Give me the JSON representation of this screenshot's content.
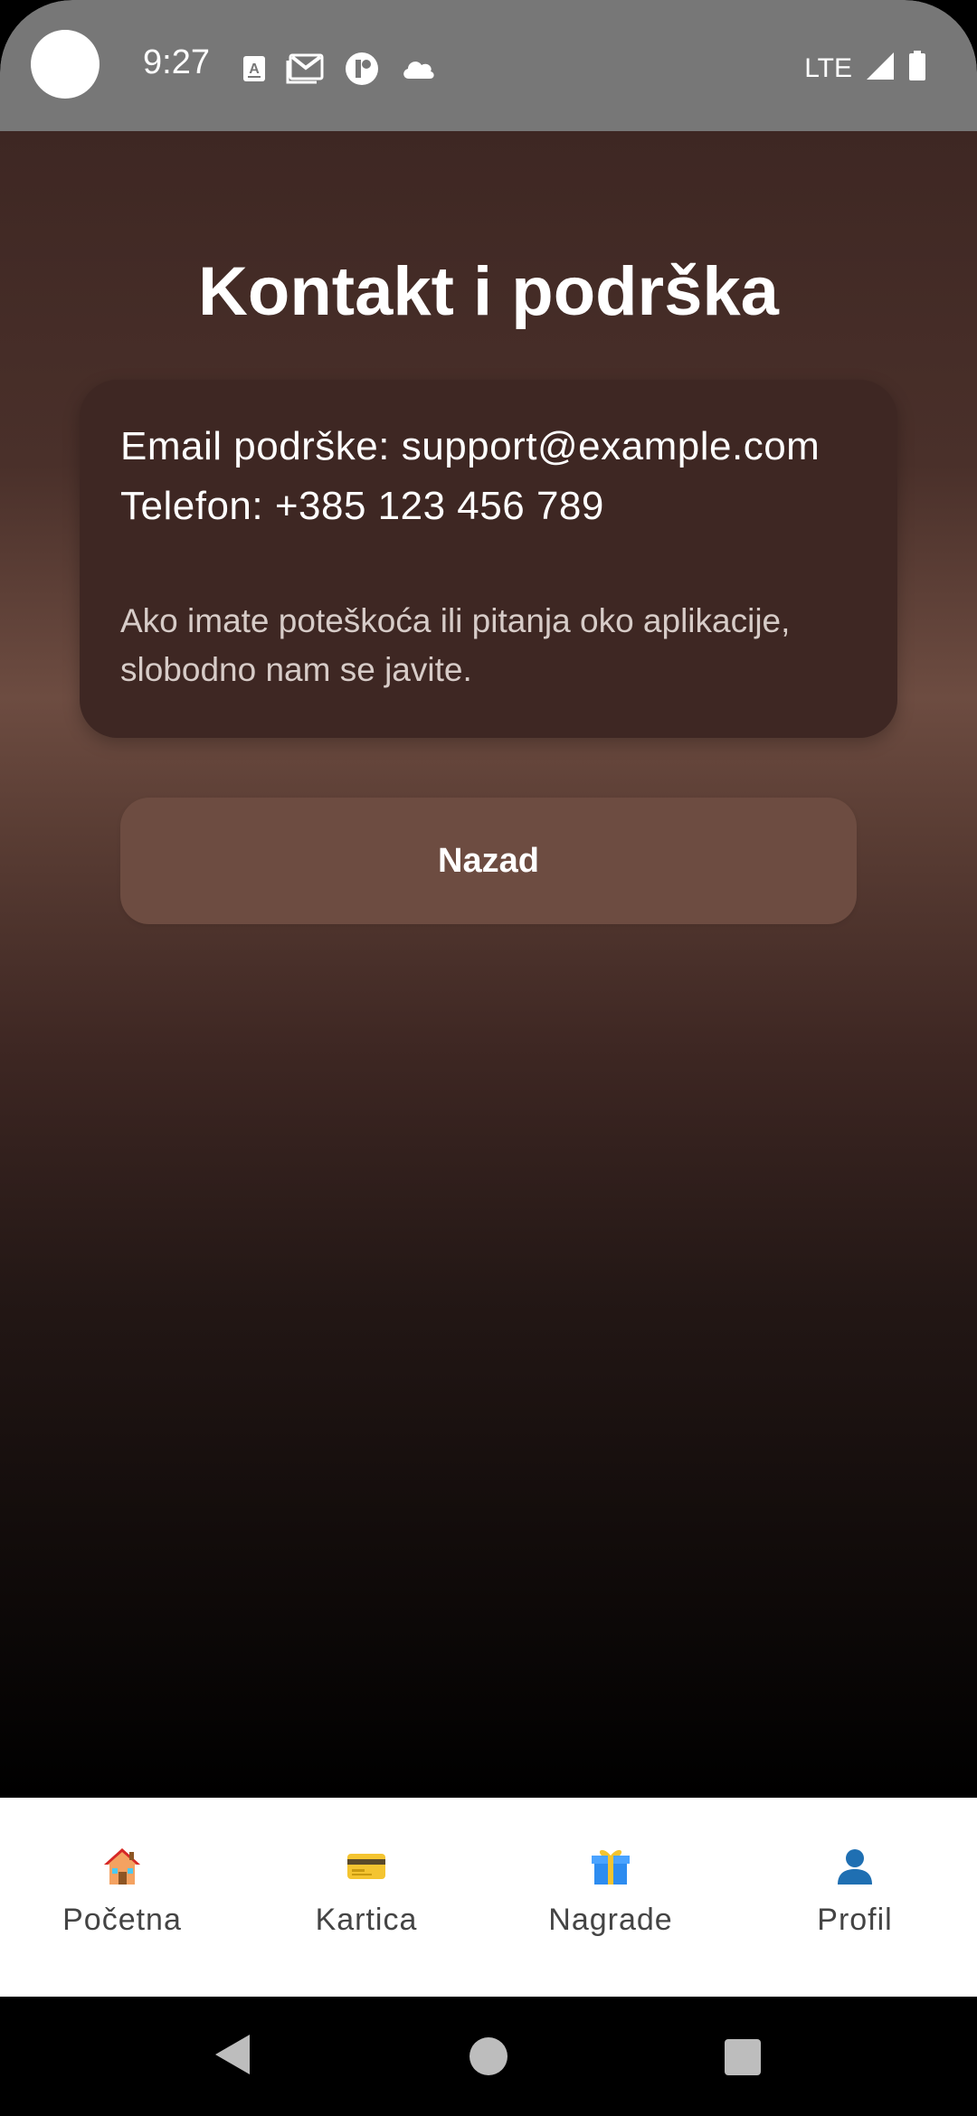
{
  "status_bar": {
    "time": "9:27",
    "network": "LTE",
    "icons": [
      "text-a-icon",
      "gmail-icon",
      "app-icon",
      "cloud-icon",
      "signal-icon",
      "battery-icon"
    ]
  },
  "page": {
    "title": "Kontakt i podrška",
    "email_line": "Email podrške: support@example.com",
    "phone_line": "Telefon: +385 123 456 789",
    "note": "Ako imate poteškoća ili pitanja oko aplikacije, slobodno nam se javite.",
    "back_label": "Nazad"
  },
  "bottom_nav": {
    "items": [
      {
        "label": "Početna",
        "icon": "house-icon"
      },
      {
        "label": "Kartica",
        "icon": "credit-card-icon"
      },
      {
        "label": "Nagrade",
        "icon": "gift-icon"
      },
      {
        "label": "Profil",
        "icon": "person-icon"
      }
    ]
  },
  "colors": {
    "card_bg": "#3e2723",
    "button_bg": "#6d4c41",
    "status_bar_bg": "#777777"
  }
}
